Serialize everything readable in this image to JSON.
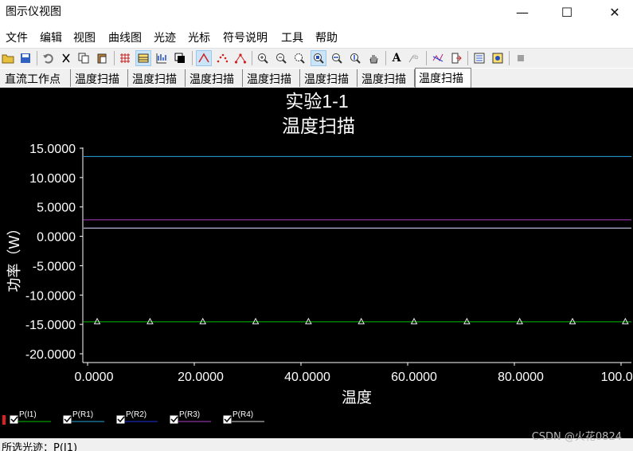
{
  "window": {
    "title": "图示仪视图",
    "minimize": "—",
    "maximize": "☐",
    "close": "✕"
  },
  "menu": [
    "文件",
    "编辑",
    "视图",
    "曲线图",
    "光迹",
    "光标",
    "符号说明",
    "工具",
    "帮助"
  ],
  "tabs": [
    {
      "label": "直流工作点",
      "active": false
    },
    {
      "label": "温度扫描",
      "active": false
    },
    {
      "label": "温度扫描",
      "active": false
    },
    {
      "label": "温度扫描",
      "active": false
    },
    {
      "label": "温度扫描",
      "active": false
    },
    {
      "label": "温度扫描",
      "active": false
    },
    {
      "label": "温度扫描",
      "active": false
    },
    {
      "label": "温度扫描",
      "active": true
    }
  ],
  "toolbar_icons": [
    "open-icon",
    "save-icon",
    "undo-icon",
    "cut-icon",
    "copy-icon",
    "paste-icon",
    "grid-icon",
    "toggle-grid-icon",
    "chart-icon",
    "select-icon",
    "line-trace-icon",
    "dots-trace-icon",
    "markers-trace-icon",
    "zoom-in-icon",
    "zoom-out-icon",
    "zoom-box-icon",
    "zoom-fit-icon",
    "zoom-x-icon",
    "zoom-y-icon",
    "pan-icon",
    "text-icon",
    "label-icon",
    "cursor-trace-icon",
    "export-icon",
    "properties-icon",
    "settings-icon",
    "stop-icon"
  ],
  "chart_data": {
    "type": "line",
    "title": "实验1-1",
    "subtitle": "温度扫描",
    "xlabel": "温度",
    "ylabel": "功率（W）",
    "xlim": [
      0,
      100
    ],
    "ylim": [
      -20,
      15
    ],
    "x_ticks": [
      "0.0000",
      "20.0000",
      "40.0000",
      "60.0000",
      "80.0000",
      "100.0000"
    ],
    "y_ticks": [
      "15.0000",
      "10.0000",
      "5.0000",
      "0.0000",
      "-5.0000",
      "-10.0000",
      "-15.0000",
      "-20.0000"
    ],
    "y_tick_values": [
      15,
      10,
      5,
      0,
      -5,
      -10,
      -15,
      -20
    ],
    "grid": false,
    "background": "#000000",
    "series": [
      {
        "name": "P(I1)",
        "color": "#00c000",
        "x": [
          0,
          100
        ],
        "values": [
          -14.55,
          -14.55
        ],
        "markers": true,
        "marker_x": [
          1.8,
          11.7,
          21.6,
          31.5,
          41.4,
          51.3,
          61.2,
          71.1,
          81.0,
          90.9,
          100.8
        ]
      },
      {
        "name": "P(R1)",
        "color": "#2aa4e0",
        "x": [
          0,
          100
        ],
        "values": [
          13.6,
          13.6
        ],
        "markers": false
      },
      {
        "name": "P(R2)",
        "color": "#2030e0",
        "x": [
          0,
          100
        ],
        "values": [
          1.4,
          1.4
        ],
        "markers": false
      },
      {
        "name": "P(R3)",
        "color": "#b040c8",
        "x": [
          0,
          100
        ],
        "values": [
          2.8,
          2.8
        ],
        "markers": false
      },
      {
        "name": "P(R4)",
        "color": "#d8d8d8",
        "x": [
          0,
          100
        ],
        "values": [
          1.4,
          1.4
        ],
        "markers": false
      }
    ],
    "legend_placement": "bottom-left"
  },
  "status": {
    "text": "所选光迹：P(I1)",
    "watermark": "CSDN @火花0824"
  }
}
